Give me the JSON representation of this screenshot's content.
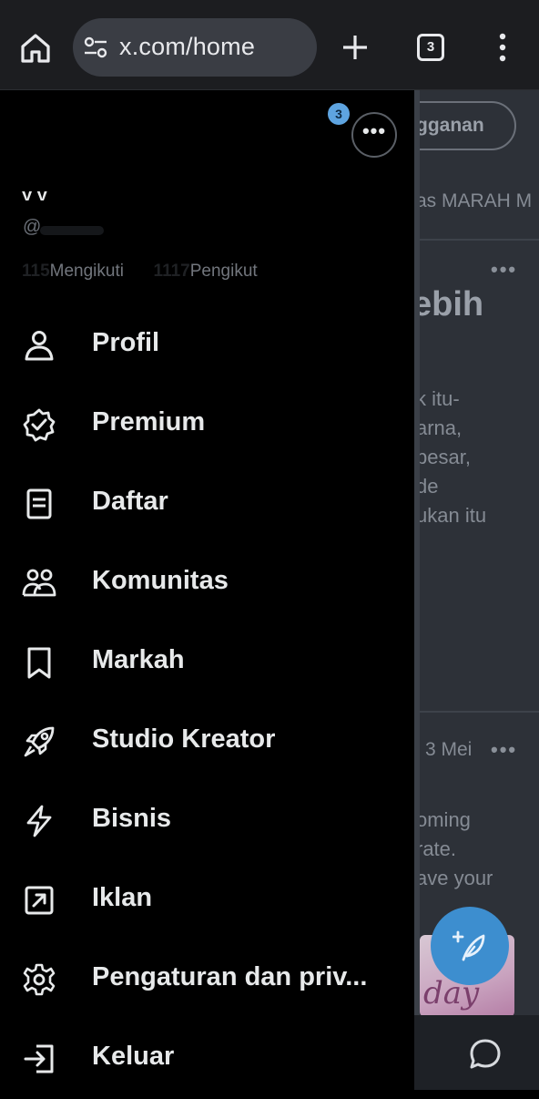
{
  "browser": {
    "url": "x.com/home",
    "tab_count": "3",
    "icons": [
      "home-icon",
      "site-settings-icon",
      "new-tab-icon",
      "tab-switcher-icon",
      "more-vert-icon"
    ]
  },
  "drawer": {
    "notification_badge": "3",
    "more_label": "•••",
    "display_name": "y y",
    "handle": "@",
    "following_count": "115",
    "following_label": "Mengikuti",
    "followers_count": "1117",
    "followers_label": "Pengikut",
    "menu": [
      {
        "label": "Profil",
        "icon": "user-icon"
      },
      {
        "label": "Premium",
        "icon": "verified-badge-icon"
      },
      {
        "label": "Daftar",
        "icon": "list-icon"
      },
      {
        "label": "Komunitas",
        "icon": "communities-icon"
      },
      {
        "label": "Markah",
        "icon": "bookmark-icon"
      },
      {
        "label": "Studio Kreator",
        "icon": "rocket-icon"
      },
      {
        "label": "Bisnis",
        "icon": "lightning-icon"
      },
      {
        "label": "Iklan",
        "icon": "external-link-icon"
      },
      {
        "label": "Pengaturan dan priv...",
        "icon": "settings-icon"
      },
      {
        "label": "Keluar",
        "icon": "logout-icon"
      }
    ]
  },
  "timeline": {
    "subscribe_button": "gganan",
    "trend_text": "as MARAH M",
    "post1_dots": "•••",
    "post1_heading": "ebih",
    "post1_lines": [
      "k itu-",
      "arna,",
      "besar,",
      "de",
      "ukan itu"
    ],
    "post2_date": "3 Mei",
    "post2_dots": "•••",
    "post2_lines": [
      "oming",
      "rate.",
      "ave your"
    ],
    "image_text": "day"
  },
  "colors": {
    "background": "#000000",
    "text_primary": "#e7e9ea",
    "fab": "#3d8ecf",
    "browser_bar": "#1c1d20"
  }
}
